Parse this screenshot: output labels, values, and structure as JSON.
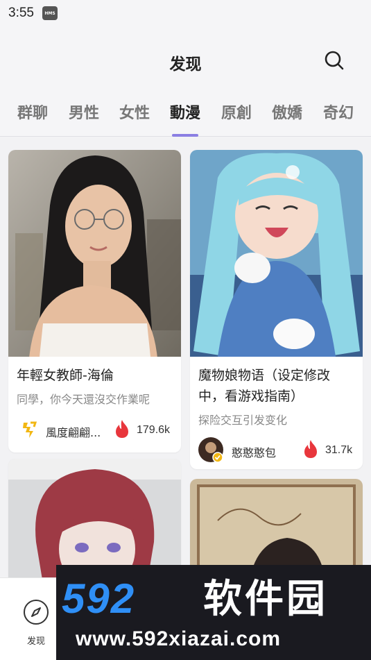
{
  "status_bar": {
    "time": "3:55",
    "badge": "HMS"
  },
  "header": {
    "title": "发现",
    "search_icon": "search-icon"
  },
  "tabs": [
    {
      "label": "群聊",
      "active": false
    },
    {
      "label": "男性",
      "active": false
    },
    {
      "label": "女性",
      "active": false
    },
    {
      "label": "動漫",
      "active": true
    },
    {
      "label": "原創",
      "active": false
    },
    {
      "label": "傲嬌",
      "active": false
    },
    {
      "label": "奇幻",
      "active": false
    }
  ],
  "accent_color": "#8b7fe3",
  "cards": [
    {
      "title": "年輕女教師-海倫",
      "description": "同學，你今天還沒交作業呢",
      "author": "風度翩翩...",
      "likes": "179.6k",
      "image": "portrait of a young woman with glasses in a classroom"
    },
    {
      "title": "魔物娘物语（设定修改中，看游戏指南）",
      "description": "探险交互引发变化",
      "author": "憨憨憨包",
      "likes": "31.7k",
      "image": "anime girl with light blue hair holding white bunnies"
    },
    {
      "image": "anime character with red hair and purple eyes"
    },
    {
      "image": "character in front of a traditional painted screen"
    }
  ],
  "bottom_nav": {
    "discover_label": "发现",
    "discover_icon": "compass-icon"
  },
  "watermark": {
    "brand": "592",
    "brand_cn": "软件园",
    "url": "www.592xiazai.com"
  }
}
